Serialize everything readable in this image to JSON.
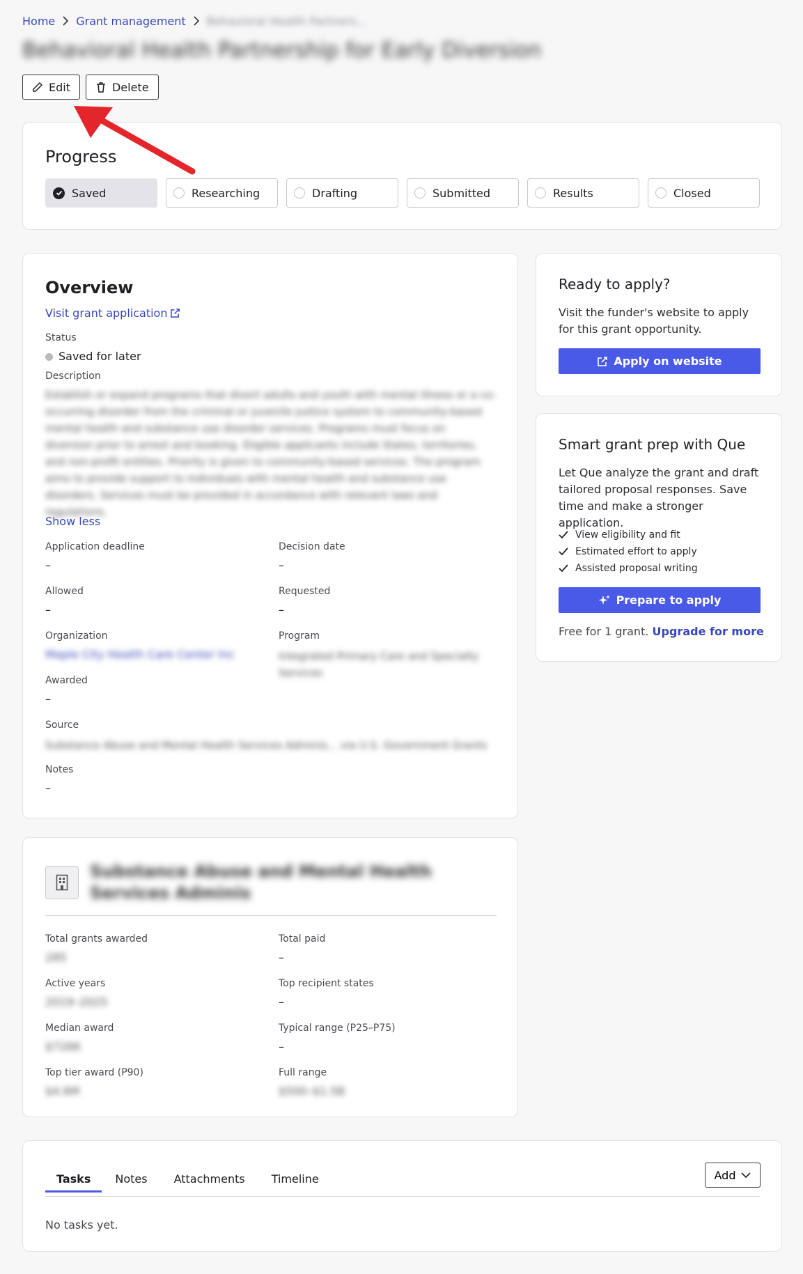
{
  "breadcrumb": {
    "home": "Home",
    "grant_management": "Grant management",
    "current": "Behavioral Health Partners..."
  },
  "page_title": "Behavioral Health Partnership for Early Diversion",
  "actions": {
    "edit": "Edit",
    "delete": "Delete"
  },
  "progress": {
    "title": "Progress",
    "steps": [
      {
        "label": "Saved",
        "state": "complete"
      },
      {
        "label": "Researching",
        "state": "pending"
      },
      {
        "label": "Drafting",
        "state": "pending"
      },
      {
        "label": "Submitted",
        "state": "pending"
      },
      {
        "label": "Results",
        "state": "pending"
      },
      {
        "label": "Closed",
        "state": "pending"
      }
    ]
  },
  "overview": {
    "title": "Overview",
    "visit_link": "Visit grant application",
    "status_label": "Status",
    "status_value": "Saved for later",
    "description_label": "Description",
    "description_text": "Establish or expand programs that divert adults and youth with mental illness or a co-occurring disorder from the criminal or juvenile justice system to community-based mental health and substance use disorder services. Programs must focus on diversion prior to arrest and booking. Eligible applicants include States, territories, and non-profit entities. Priority is given to community-based services. The program aims to provide support to individuals with mental health and substance use disorders. Services must be provided in accordance with relevant laws and regulations.",
    "show_less": "Show less",
    "fields": {
      "application_deadline": {
        "label": "Application deadline",
        "value": "–"
      },
      "decision_date": {
        "label": "Decision date",
        "value": "–"
      },
      "allowed": {
        "label": "Allowed",
        "value": "–"
      },
      "requested": {
        "label": "Requested",
        "value": "–"
      },
      "organization": {
        "label": "Organization",
        "value": "Maple City Health Care Center Inc"
      },
      "program": {
        "label": "Program",
        "value": "Integrated Primary Care and Specialty Services"
      },
      "awarded": {
        "label": "Awarded",
        "value": "–"
      },
      "source": {
        "label": "Source",
        "value": "Substance Abuse and Mental Health Services Adminis... via U.S. Government Grants"
      },
      "notes": {
        "label": "Notes",
        "value": "–"
      }
    }
  },
  "agency": {
    "icon": "building-icon",
    "name": "Substance Abuse and Mental Health Services Adminis",
    "stats": {
      "total_grants_awarded": {
        "label": "Total grants awarded",
        "value": "285"
      },
      "total_paid": {
        "label": "Total paid",
        "value": "–"
      },
      "active_years": {
        "label": "Active years",
        "value": "2019–2025"
      },
      "top_recipient_states": {
        "label": "Top recipient states",
        "value": "–"
      },
      "median_award": {
        "label": "Median award",
        "value": "$726K"
      },
      "typical_range": {
        "label": "Typical range (P25–P75)",
        "value": "–"
      },
      "top_tier_award": {
        "label": "Top tier award (P90)",
        "value": "$4.6M"
      },
      "full_range": {
        "label": "Full range",
        "value": "$500–$1.5B"
      }
    }
  },
  "apply_card": {
    "title": "Ready to apply?",
    "text": "Visit the funder's website to apply for this grant opportunity.",
    "button": "Apply on website"
  },
  "que_card": {
    "title": "Smart grant prep with Que",
    "text": "Let Que analyze the grant and draft tailored proposal responses. Save time and make a stronger application.",
    "checklist": [
      "View eligibility and fit",
      "Estimated effort to apply",
      "Assisted proposal writing"
    ],
    "button": "Prepare to apply",
    "free_text": "Free for 1 grant.",
    "upgrade_link": "Upgrade for more"
  },
  "tabs": {
    "items": [
      "Tasks",
      "Notes",
      "Attachments",
      "Timeline"
    ],
    "active": "Tasks",
    "add_button": "Add",
    "empty_text": "No tasks yet."
  },
  "colors": {
    "accent": "#4a5ae8",
    "link": "#3848b8",
    "annotation_arrow": "#e3262b"
  }
}
